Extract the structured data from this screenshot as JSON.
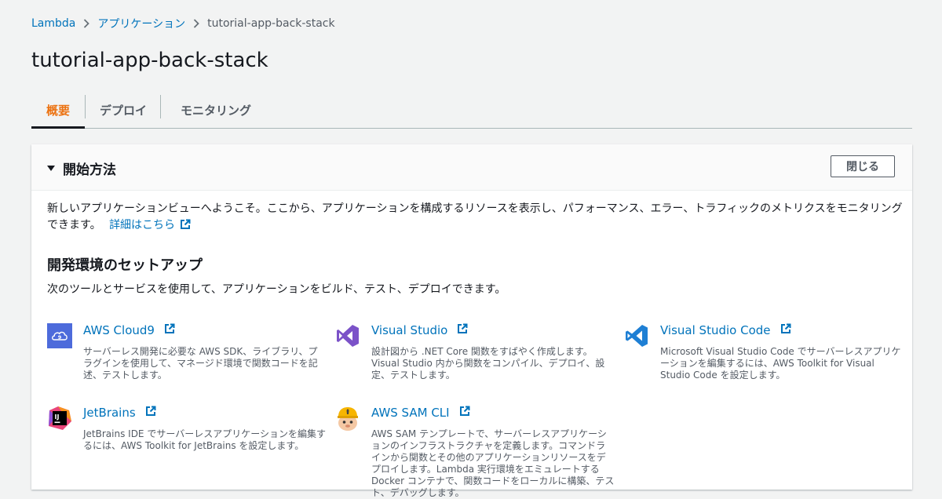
{
  "breadcrumb": {
    "lambda": "Lambda",
    "applications": "アプリケーション",
    "current": "tutorial-app-back-stack"
  },
  "page_title": "tutorial-app-back-stack",
  "tabs": [
    {
      "label": "概要",
      "active": true
    },
    {
      "label": "デプロイ",
      "active": false
    },
    {
      "label": "モニタリング",
      "active": false
    }
  ],
  "getting_started": {
    "title": "開始方法",
    "close_label": "閉じる",
    "intro_text": "新しいアプリケーションビューへようこそ。ここから、アプリケーションを構成するリソースを表示し、パフォーマンス、エラー、トラフィックのメトリクスをモニタリングできます。",
    "learn_more": "詳細はこちら",
    "setup_title": "開発環境のセットアップ",
    "setup_desc": "次のツールとサービスを使用して、アプリケーションをビルド、テスト、デプロイできます。",
    "tools": [
      {
        "name": "AWS Cloud9",
        "icon": "cloud9-icon",
        "desc": "サーバーレス開発に必要な AWS SDK、ライブラリ、プラグインを使用して、マネージド環境で関数コードを記述、テストします。"
      },
      {
        "name": "Visual Studio",
        "icon": "visual-studio-icon",
        "desc": "設計図から .NET Core 関数をすばやく作成します。Visual Studio 内から関数をコンパイル、デプロイ、設定、テストします。"
      },
      {
        "name": "Visual Studio Code",
        "icon": "vscode-icon",
        "desc": "Microsoft Visual Studio Code でサーバーレスアプリケーションを編集するには、AWS Toolkit for Visual Studio Code を設定します。"
      },
      {
        "name": "JetBrains",
        "icon": "jetbrains-icon",
        "desc": "JetBrains IDE でサーバーレスアプリケーションを編集するには、AWS Toolkit for JetBrains を設定します。"
      },
      {
        "name": "AWS SAM CLI",
        "icon": "sam-squirrel-icon",
        "desc": "AWS SAM テンプレートで、サーバーレスアプリケーションのインフラストラクチャを定義します。コマンドラインから関数とその他のアプリケーションリソースをデプロイします。Lambda 実行環境をエミュレートする Docker コンテナで、関数コードをローカルに構築、テスト、デバッグします。"
      }
    ]
  },
  "colors": {
    "link": "#0073bb",
    "active_tab": "#ec7211",
    "background": "#f2f3f3"
  }
}
